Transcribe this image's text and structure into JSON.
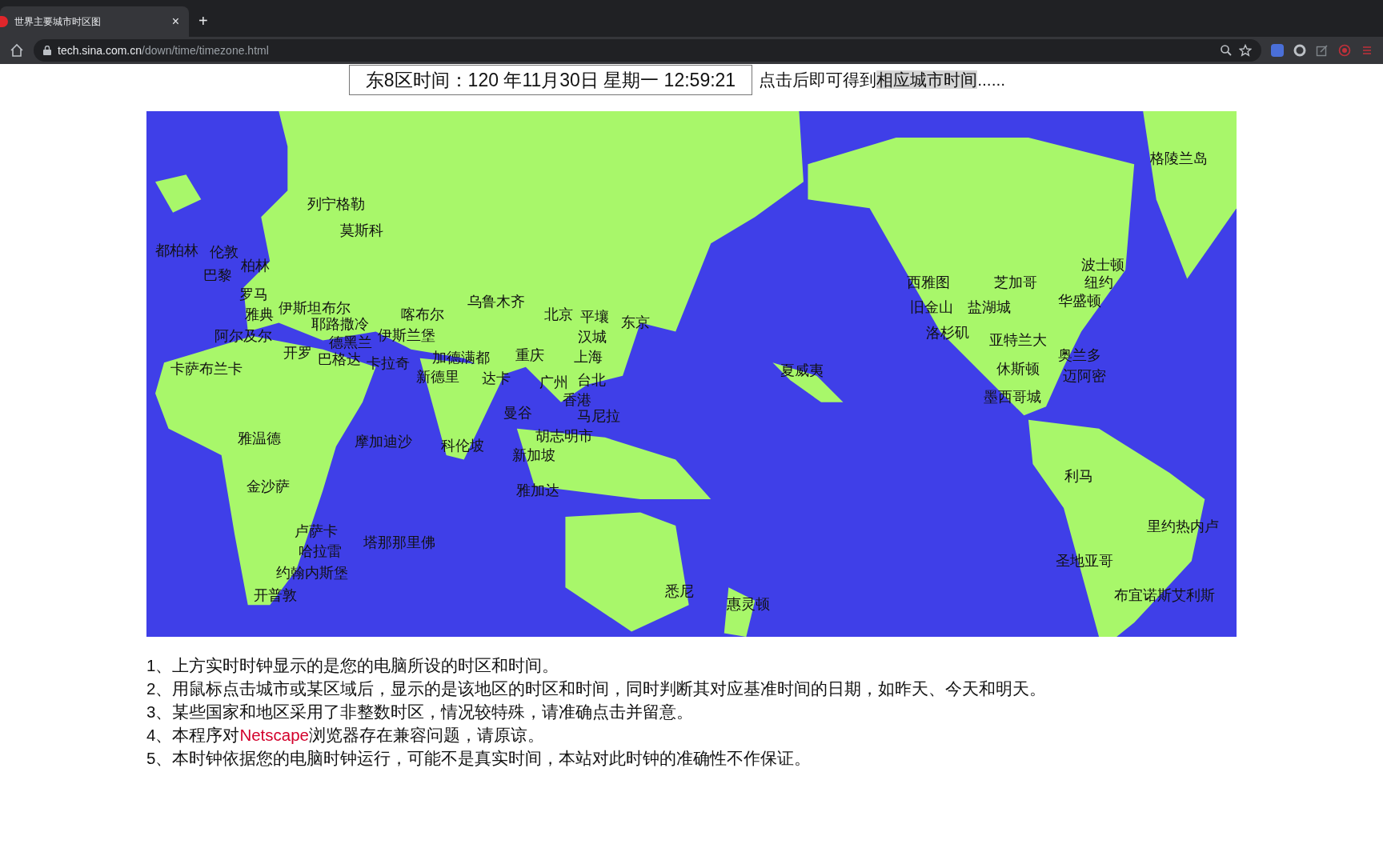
{
  "browser": {
    "tab": {
      "title": "世界主要城市时区图",
      "close": "×",
      "selected": true
    },
    "new_tab": "+",
    "address": {
      "host": "tech.sina.com.cn",
      "path": "/down/time/timezone.html"
    }
  },
  "clock": {
    "text": "东8区时间：120 年11月30日 星期一 12:59:21"
  },
  "hint": {
    "before": "点击后即可得到",
    "highlighted": "相应城市时间",
    "after": "......"
  },
  "map": {
    "kind": "picture",
    "cities": [
      "列宁格勒",
      "莫斯科",
      "都柏林",
      "伦敦",
      "柏林",
      "巴黎",
      "罗马",
      "伊斯坦布尔",
      "雅典",
      "耶路撒冷",
      "喀布尔",
      "乌鲁木齐",
      "北京",
      "平壤",
      "东京",
      "阿尔及尔",
      "德黑兰",
      "伊斯兰堡",
      "汉城",
      "开罗",
      "巴格达",
      "卡拉奇",
      "加德满都",
      "重庆",
      "上海",
      "卡萨布兰卡",
      "新德里",
      "达卡",
      "广州",
      "台北",
      "夏威夷",
      "香港",
      "曼谷",
      "马尼拉",
      "雅温德",
      "摩加迪沙",
      "科伦坡",
      "胡志明市",
      "新加坡",
      "金沙萨",
      "雅加达",
      "卢萨卡",
      "塔那那里佛",
      "哈拉雷",
      "约翰内斯堡",
      "开普敦",
      "悉尼",
      "惠灵顿",
      "格陵兰岛",
      "波士顿",
      "西雅图",
      "芝加哥",
      "纽约",
      "华盛顿",
      "旧金山",
      "盐湖城",
      "洛杉矶",
      "亚特兰大",
      "奥兰多",
      "休斯顿",
      "迈阿密",
      "墨西哥城",
      "利马",
      "里约热内卢",
      "圣地亚哥",
      "布宜诺斯艾利斯"
    ]
  },
  "notes": [
    {
      "parts": [
        {
          "text": "1、上方实时时钟显示的是您的电脑所设的时区和时间。",
          "kind": "plain"
        }
      ]
    },
    {
      "parts": [
        {
          "text": "2、用鼠标点击城市或某区域后，显示的是该地区的时区和时间，同时判断其对应基准时间的日期，如昨天、今天和明天。",
          "kind": "plain"
        }
      ]
    },
    {
      "parts": [
        {
          "text": "3、某些国家和地区采用了非整数时区，情况较特殊，请准确点击并留意。",
          "kind": "plain"
        }
      ]
    },
    {
      "parts": [
        {
          "text": "4、本程序对",
          "kind": "plain"
        },
        {
          "text": "Netscape",
          "kind": "link"
        },
        {
          "text": "浏览器存在兼容问题，请原谅。",
          "kind": "plain"
        }
      ]
    },
    {
      "parts": [
        {
          "text": "5、本时钟依据您的电脑时钟运行，可能不是真实时间，本站对此时钟的准确性不作保证。",
          "kind": "plain"
        }
      ]
    }
  ]
}
